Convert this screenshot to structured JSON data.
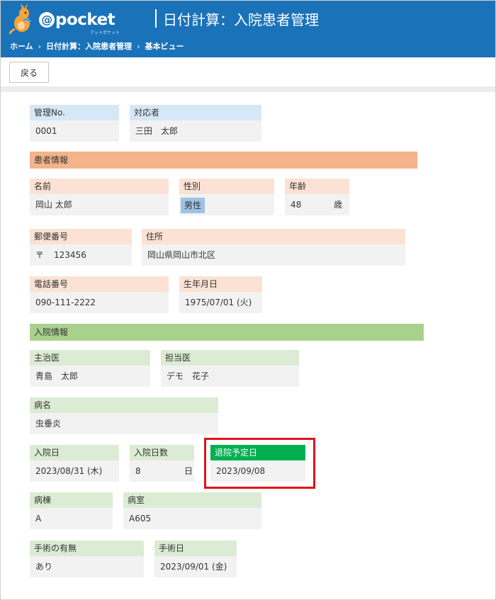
{
  "header": {
    "logo_text": "pocket",
    "logo_at": "@",
    "logo_sub": "アットポケット",
    "title": "日付計算：入院患者管理"
  },
  "breadcrumb": {
    "home": "ホーム",
    "sep1": "›",
    "app": "日付計算：入院患者管理",
    "sep2": "›",
    "view": "基本ビュー"
  },
  "toolbar": {
    "back_label": "戻る"
  },
  "record": {
    "management_no": {
      "label": "管理No.",
      "value": "0001"
    },
    "handler": {
      "label": "対応者",
      "value": "三田　太郎"
    }
  },
  "patient": {
    "section_title": "患者情報",
    "name": {
      "label": "名前",
      "value": "岡山 太郎"
    },
    "gender": {
      "label": "性別",
      "value": "男性"
    },
    "age": {
      "label": "年齢",
      "value": "48",
      "unit": "歳"
    },
    "postal": {
      "label": "郵便番号",
      "prefix": "〒",
      "value": "123456"
    },
    "address": {
      "label": "住所",
      "value": "岡山県岡山市北区"
    },
    "phone": {
      "label": "電話番号",
      "value": "090-111-2222"
    },
    "birthdate": {
      "label": "生年月日",
      "value": "1975/07/01 (火)"
    }
  },
  "admission": {
    "section_title": "入院情報",
    "attending": {
      "label": "主治医",
      "value": "青島　太郎"
    },
    "assigned": {
      "label": "担当医",
      "value": "デモ　花子"
    },
    "disease": {
      "label": "病名",
      "value": "虫垂炎"
    },
    "admit_date": {
      "label": "入院日",
      "value": "2023/08/31 (木)"
    },
    "admit_days": {
      "label": "入院日数",
      "value": "8",
      "unit": "日"
    },
    "discharge_date": {
      "label": "退院予定日",
      "value": "2023/09/08"
    },
    "ward": {
      "label": "病棟",
      "value": "A"
    },
    "room": {
      "label": "病室",
      "value": "A605"
    },
    "surgery": {
      "label": "手術の有無",
      "value": "あり"
    },
    "surgery_date": {
      "label": "手術日",
      "value": "2023/09/01 (金)"
    }
  },
  "colors": {
    "header_bg": "#1a72b9",
    "patient_section": "#f5b38b",
    "admit_section": "#a9d18e",
    "accent_label": "#00b050",
    "highlight_border": "#e0141b"
  }
}
